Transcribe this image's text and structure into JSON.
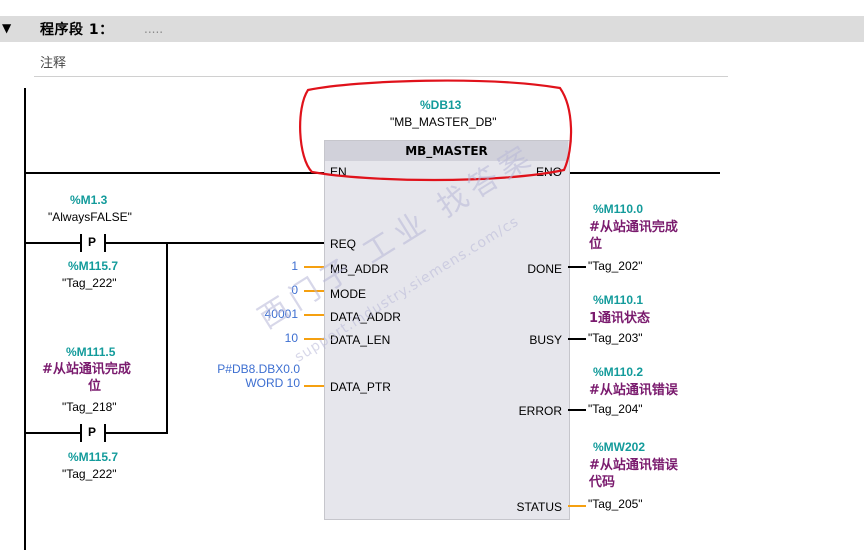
{
  "network": {
    "title": "程序段 1：",
    "dots": ".....",
    "comment": "注释"
  },
  "block": {
    "instance_address": "%DB13",
    "instance_name": "\"MB_MASTER_DB\"",
    "type_name": "MB_MASTER",
    "inputs": {
      "en": "EN",
      "req": "REQ",
      "mb_addr": "MB_ADDR",
      "mode": "MODE",
      "data_addr": "DATA_ADDR",
      "data_len": "DATA_LEN",
      "data_ptr": "DATA_PTR"
    },
    "outputs": {
      "eno": "ENO",
      "done": "DONE",
      "busy": "BUSY",
      "error": "ERROR",
      "status": "STATUS"
    }
  },
  "input_values": {
    "mb_addr": "1",
    "mode": "0",
    "data_addr": "40001",
    "data_len": "10",
    "data_ptr_line1": "P#DB8.DBX0.0",
    "data_ptr_line2": "WORD 10"
  },
  "contacts": {
    "top": {
      "address": "%M1.3",
      "tag": "\"AlwaysFALSE\"",
      "type": "P",
      "edge_address": "%M115.7",
      "edge_tag": "\"Tag_222\""
    },
    "bottom": {
      "address": "%M111.5",
      "comment_line1": "#从站通讯完成",
      "comment_line2": "位",
      "tag": "\"Tag_218\"",
      "type": "P",
      "edge_address": "%M115.7",
      "edge_tag": "\"Tag_222\""
    }
  },
  "outputs": {
    "done": {
      "address": "%M110.0",
      "comment_line1": "#从站通讯完成",
      "comment_line2": "位",
      "tag": "\"Tag_202\""
    },
    "busy": {
      "address": "%M110.1",
      "comment_line1": "1通讯状态",
      "tag": "\"Tag_203\""
    },
    "error": {
      "address": "%M110.2",
      "comment_line1": "#从站通讯错误",
      "tag": "\"Tag_204\""
    },
    "status": {
      "address": "%MW202",
      "comment_line1": "#从站通讯错误",
      "comment_line2": "代码",
      "tag": "\"Tag_205\""
    }
  },
  "watermark": {
    "line1": "西门子 工业 找答案",
    "line2": "support.industry.siemens.com/cs"
  },
  "colors": {
    "address": "#139b9b",
    "comment": "#7a1b6e",
    "literal": "#3d6fd1",
    "stub": "#f5a010",
    "annotation": "#e0121b",
    "block_body": "#e6e6ec",
    "header_bar": "#dcdcdc"
  }
}
